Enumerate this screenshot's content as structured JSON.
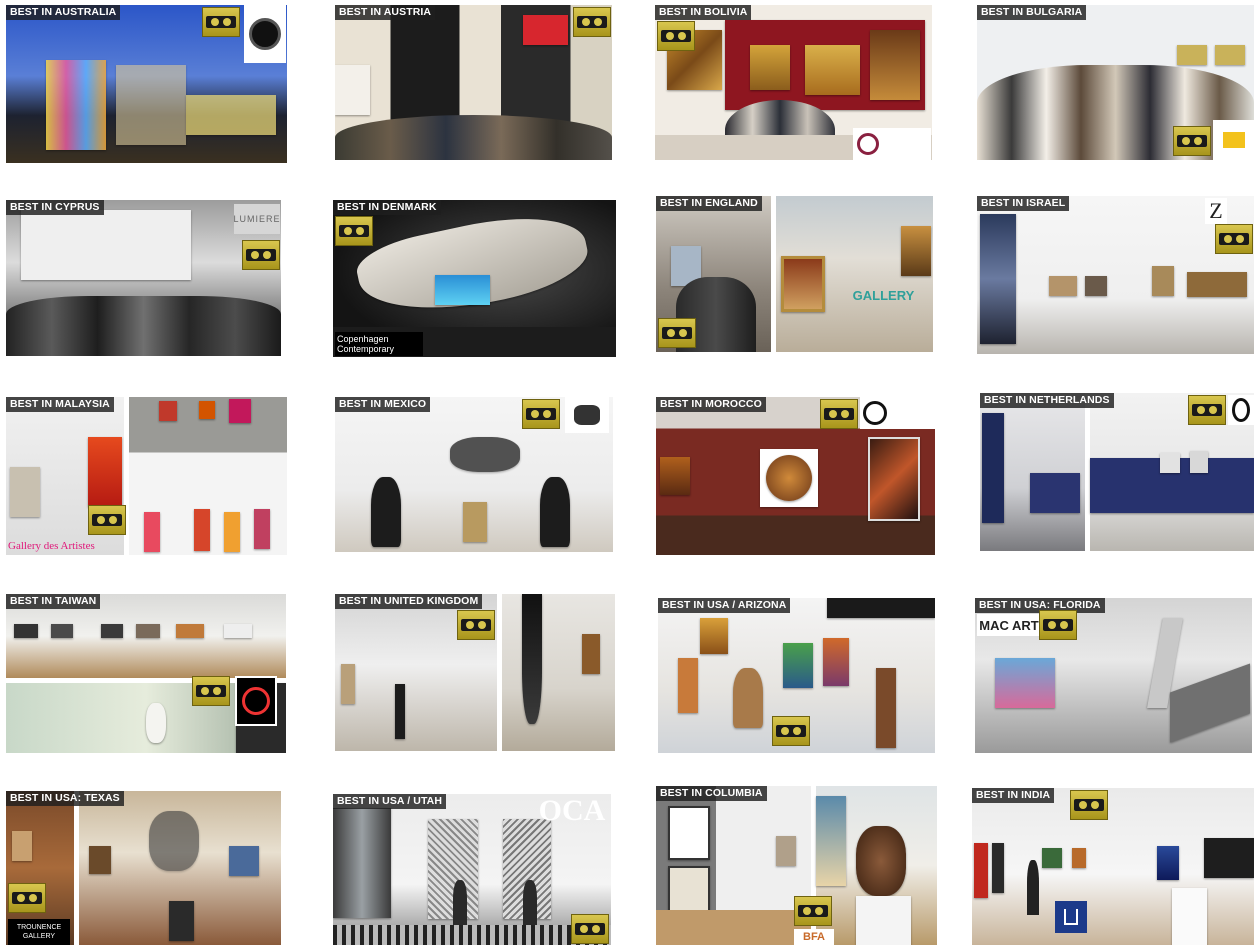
{
  "tiles": [
    {
      "caption": "BEST IN AUSTRALIA"
    },
    {
      "caption": "BEST IN AUSTRIA"
    },
    {
      "caption": "BEST IN BOLIVIA"
    },
    {
      "caption": "BEST IN BULGARIA"
    },
    {
      "caption": "BEST IN CYPRUS"
    },
    {
      "caption": "BEST IN DENMARK"
    },
    {
      "caption": "BEST IN ENGLAND"
    },
    {
      "caption": "BEST IN ISRAEL"
    },
    {
      "caption": "BEST IN MALAYSIA"
    },
    {
      "caption": "BEST IN MEXICO"
    },
    {
      "caption": "BEST IN MOROCCO"
    },
    {
      "caption": "BEST IN NETHERLANDS"
    },
    {
      "caption": "BEST IN TAIWAN"
    },
    {
      "caption": "BEST IN UNITED KINGDOM"
    },
    {
      "caption": "BEST IN USA / ARIZONA"
    },
    {
      "caption": "BEST IN USA: FLORIDA"
    },
    {
      "caption": "BEST IN USA: TEXAS"
    },
    {
      "caption": "BEST IN USA / UTAH"
    },
    {
      "caption": "BEST IN COLUMBIA"
    },
    {
      "caption": "BEST IN INDIA"
    }
  ],
  "logos": {
    "cyprus": "LUMIERE",
    "denmark": "Copenhagen Contemporary",
    "england": "GALLERY",
    "israel": "Z",
    "malaysia": "Gallery des Artistes",
    "florida": "MAC ART",
    "texas": "TROUNENCE GALLERY",
    "utah": "OCA",
    "columbia": "BFA"
  },
  "colors": {
    "badge_gold": "#c9b636",
    "caption_bg": "#1e1e1e",
    "caption_text": "#ffffff"
  }
}
